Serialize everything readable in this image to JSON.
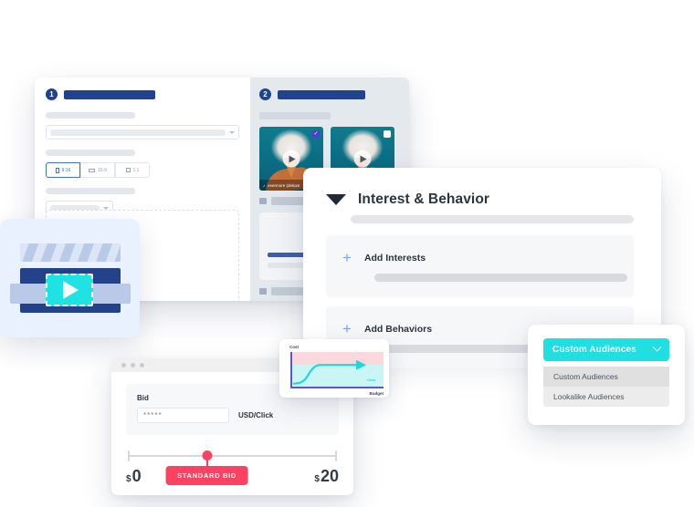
{
  "editor": {
    "pane1": {
      "step_number": "1",
      "ratio_options": [
        {
          "label": "9:16",
          "shape": "v",
          "active": true
        },
        {
          "label": "16:9",
          "shape": "h",
          "active": false
        },
        {
          "label": "1:1",
          "shape": "s",
          "active": false
        }
      ],
      "mini_buttons": [
        {
          "icon": "image-icon",
          "glyph": "▣"
        },
        {
          "icon": "photo-icon",
          "glyph": "◉"
        }
      ]
    },
    "pane2": {
      "step_number": "2",
      "thumbnails": [
        {
          "name": "video-thumbnail-selected",
          "selected": true,
          "check_glyph": "✓",
          "music_label": "evermore (deluxe"
        },
        {
          "name": "video-thumbnail",
          "selected": false,
          "check_glyph": "",
          "music_label": ""
        }
      ]
    }
  },
  "clapperboard": {
    "icon": "video-clapperboard-icon",
    "play": "play-icon"
  },
  "interest_panel": {
    "title": "Interest & Behavior",
    "caret": "caret-down-icon",
    "blocks": [
      {
        "plus": "+",
        "label": "Add Interests"
      },
      {
        "plus": "+",
        "label": "Add Behaviors"
      }
    ]
  },
  "custom_audiences": {
    "button_label": "Custom Audiences",
    "chevron": "chevron-down-icon",
    "options": [
      {
        "label": "Custom Audiences",
        "selected": true
      },
      {
        "label": "Lookalike Audiences",
        "selected": false
      }
    ]
  },
  "bid_window": {
    "field_label": "Bid",
    "input_value": "*****",
    "input_placeholder": "",
    "unit_label": "USD/Click",
    "slider": {
      "min_currency": "$",
      "min_value": "0",
      "max_currency": "$",
      "max_value": "20",
      "badge_label": "STANDARD BID",
      "knob_percent": 38
    }
  },
  "chart_data": {
    "type": "line",
    "title": "Cost",
    "xlabel": "Budget",
    "ylabel": "Cost",
    "annotations": [
      "Cost"
    ],
    "series": [
      {
        "name": "Cost",
        "x": [
          0,
          0.08,
          0.16,
          0.24,
          0.32,
          0.45,
          0.6,
          0.8,
          1.0
        ],
        "y": [
          0.1,
          0.11,
          0.15,
          0.3,
          0.52,
          0.62,
          0.63,
          0.63,
          0.63
        ]
      }
    ],
    "bands": [
      {
        "name": "upper-band",
        "color": "#fbd7de",
        "from": 0.66,
        "to": 1.0
      },
      {
        "name": "lower-band",
        "color": "#c9f5f5",
        "from": 0.0,
        "to": 0.66
      }
    ],
    "xlim": [
      0,
      1
    ],
    "ylim": [
      0,
      1
    ],
    "grid": false,
    "legend": "none"
  },
  "colors": {
    "brand_blue": "#21438f",
    "accent_cyan": "#1fdfe0",
    "accent_pink": "#fb4263",
    "panel_gray": "#e4e9ee"
  }
}
